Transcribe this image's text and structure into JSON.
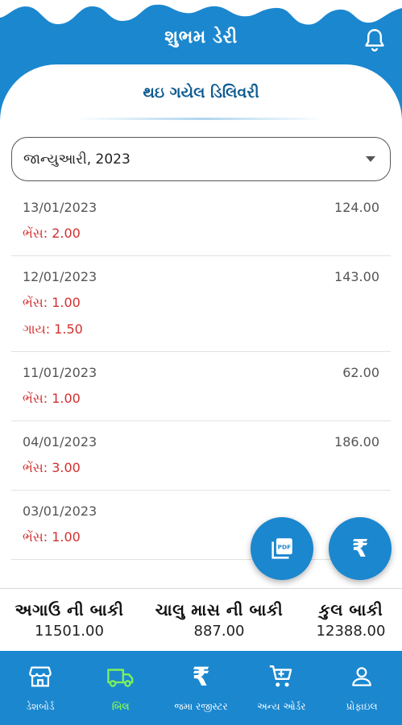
{
  "app_title": "શુભમ ડેરી",
  "section_title": "થઇ ગયેલ ડિલિવરી",
  "month_select": {
    "value": "જાન્યુઆરી, 2023"
  },
  "deliveries": [
    {
      "date": "13/01/2023",
      "amount": "124.00",
      "lines": [
        "ભેંસ: 2.00"
      ]
    },
    {
      "date": "12/01/2023",
      "amount": "143.00",
      "lines": [
        "ભેંસ: 1.00",
        "ગાય: 1.50"
      ]
    },
    {
      "date": "11/01/2023",
      "amount": "62.00",
      "lines": [
        "ભેંસ: 1.00"
      ]
    },
    {
      "date": "04/01/2023",
      "amount": "186.00",
      "lines": [
        "ભેંસ: 3.00"
      ]
    },
    {
      "date": "03/01/2023",
      "amount": "",
      "lines": [
        "ભેંસ: 1.00"
      ]
    }
  ],
  "fab": {
    "pdf_icon": "pdf-icon",
    "rupee_symbol": "₹"
  },
  "totals": [
    {
      "label": "અગાઉ ની બાકી",
      "value": "11501.00"
    },
    {
      "label": "ચાલુ માસ ની બાકી",
      "value": "887.00"
    },
    {
      "label": "કુલ બાકી",
      "value": "12388.00"
    }
  ],
  "nav": [
    {
      "label": "ડેશબોર્ડ",
      "icon": "store-icon",
      "active": false
    },
    {
      "label": "બિલ",
      "icon": "truck-icon",
      "active": true
    },
    {
      "label": "જમા રજીસ્ટર",
      "icon": "rupee-icon",
      "active": false
    },
    {
      "label": "અન્ય ઓર્ડર",
      "icon": "cart-icon",
      "active": false
    },
    {
      "label": "પ્રોફાઇલ",
      "icon": "person-icon",
      "active": false
    }
  ],
  "colors": {
    "primary": "#1b87cf",
    "title": "#0f5c92",
    "accent_red": "#d32f2f",
    "active_nav": "#7cf05a"
  }
}
